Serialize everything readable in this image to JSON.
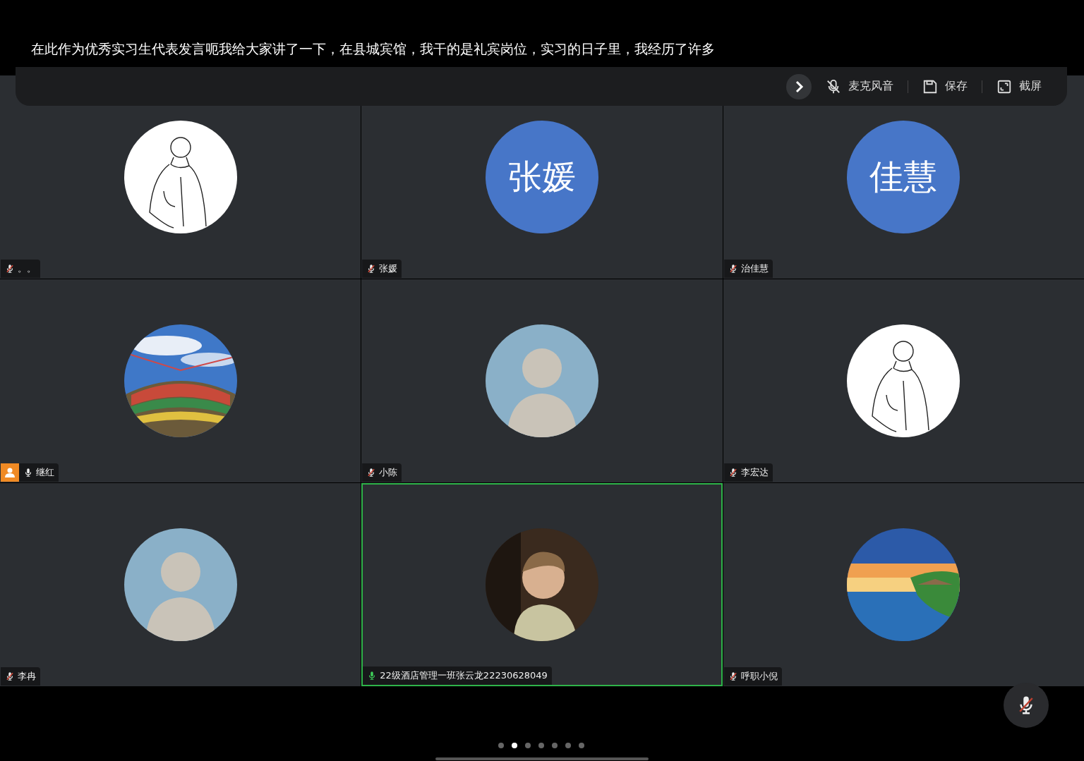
{
  "caption": "在此作为优秀实习生代表发言呃我给大家讲了一下，在县城宾馆，我干的是礼宾岗位，实习的日子里，我经历了许多",
  "toolbar": {
    "items": [
      {
        "kind": "mic-off",
        "label": "麦克风音"
      },
      {
        "kind": "save",
        "label": "保存"
      },
      {
        "kind": "screenshot",
        "label": "截屏"
      }
    ]
  },
  "participants": [
    {
      "name": "。。",
      "avatar": {
        "kind": "sketch"
      },
      "muted": true,
      "speaking": false,
      "host": false,
      "selected": false
    },
    {
      "name": "张媛",
      "avatar": {
        "kind": "initials",
        "text": "张媛"
      },
      "muted": true,
      "speaking": false,
      "host": false,
      "selected": false
    },
    {
      "name": "治佳慧",
      "avatar": {
        "kind": "initials",
        "text": "佳慧"
      },
      "muted": true,
      "speaking": false,
      "host": false,
      "selected": false
    },
    {
      "name": "继红",
      "muted": false,
      "speaking": false,
      "host": true,
      "selected": false
    },
    {
      "name": "小陈",
      "avatar": {
        "kind": "figure"
      },
      "muted": true,
      "speaking": false,
      "host": false,
      "selected": false
    },
    {
      "name": "李宏达",
      "avatar": {
        "kind": "sketch"
      },
      "muted": true,
      "speaking": false,
      "host": false,
      "selected": false
    },
    {
      "name": "李冉",
      "avatar": {
        "kind": "figure"
      },
      "muted": true,
      "speaking": false,
      "host": false,
      "selected": false
    },
    {
      "name": "22级酒店管理一班张云龙22230628049",
      "muted": false,
      "speaking": true,
      "host": false,
      "selected": true
    },
    {
      "name": "呼职小倪",
      "muted": true,
      "speaking": false,
      "host": false,
      "selected": false
    }
  ],
  "self_mic": {
    "muted": true
  },
  "pages": [
    {
      "selected": false
    },
    {
      "selected": true
    },
    {
      "selected": false
    },
    {
      "selected": false
    },
    {
      "selected": false
    },
    {
      "selected": false
    },
    {
      "selected": false
    }
  ]
}
